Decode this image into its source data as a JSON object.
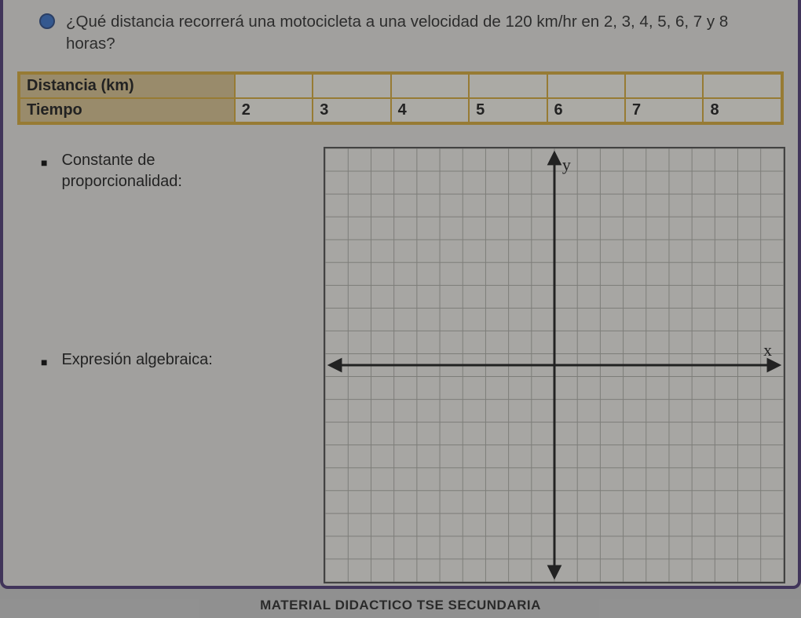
{
  "question": "¿Qué distancia recorrerá una motocicleta a una velocidad de 120 km/hr en 2, 3, 4, 5, 6, 7 y 8 horas?",
  "table": {
    "row1_header": "Distancia (km)",
    "row1": [
      "",
      "",
      "",
      "",
      "",
      "",
      ""
    ],
    "row2_header": "Tiempo",
    "row2": [
      "2",
      "3",
      "4",
      "5",
      "6",
      "7",
      "8"
    ]
  },
  "prompts": {
    "constant": "Constante de proporcionalidad:",
    "expression": "Expresión algebraica:"
  },
  "axes": {
    "x_label": "x",
    "y_label": "y"
  },
  "footer": "MATERIAL DIDACTICO TSE   SECUNDARIA"
}
